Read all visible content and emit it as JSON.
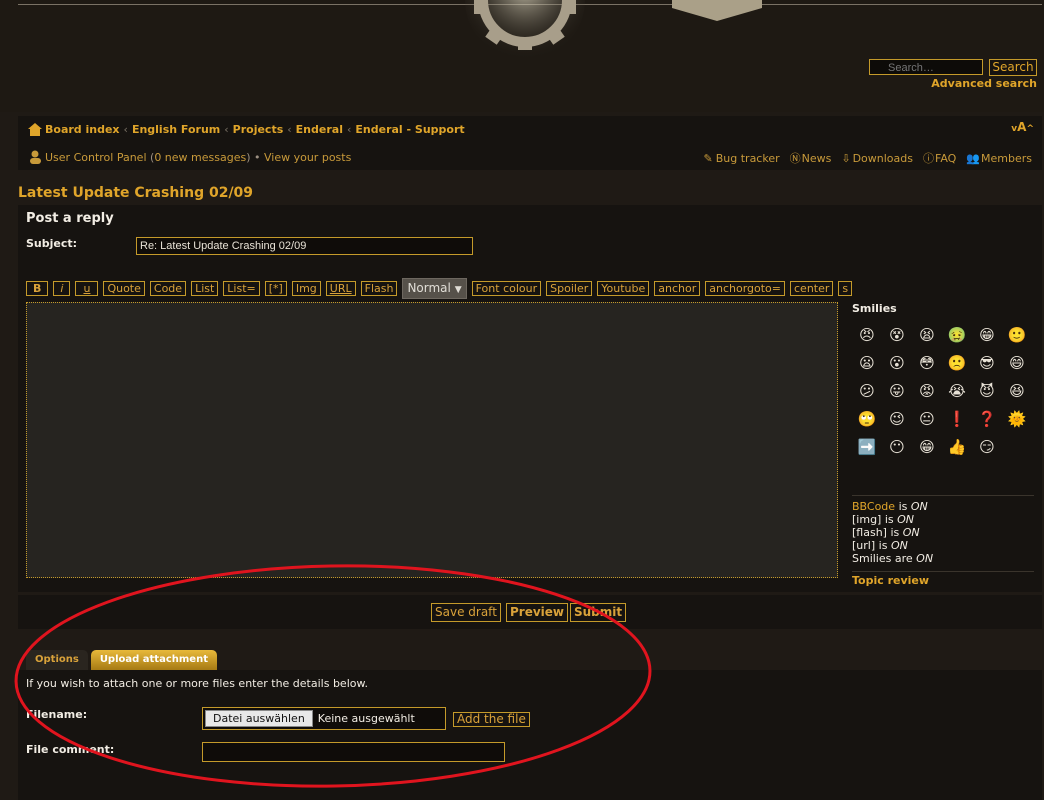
{
  "header": {
    "search_placeholder": "Search…",
    "search_button": "Search",
    "advanced_search": "Advanced search"
  },
  "nav": {
    "breadcrumbs": [
      "Board index",
      "English Forum",
      "Projects",
      "Enderal",
      "Enderal - Support"
    ],
    "font_size_label": "A",
    "ucp": "User Control Panel",
    "messages": "0 new messages",
    "view_posts": "View your posts",
    "links": [
      "Bug tracker",
      "News",
      "Downloads",
      "FAQ",
      "Members"
    ]
  },
  "topic": {
    "title": "Latest Update Crashing 02/09"
  },
  "post": {
    "heading": "Post a reply",
    "subject_label": "Subject:",
    "subject_value": "Re: Latest Update Crashing 02/09"
  },
  "toolbar": {
    "buttons": [
      "B",
      "i",
      "u",
      "Quote",
      "Code",
      "List",
      "List=",
      "[*]",
      "Img",
      "URL",
      "Flash"
    ],
    "size_select": "Normal",
    "buttons2": [
      "Font colour",
      "Spoiler",
      "Youtube",
      "anchor",
      "anchorgoto=",
      "center",
      "s"
    ]
  },
  "smilies": {
    "heading": "Smilies",
    "icons": [
      "😠",
      "😵",
      "😫",
      "🤢",
      "😁",
      "🙂",
      "😦",
      "😮",
      "😳",
      "🙁",
      "😎",
      "😄",
      "😕",
      "😛",
      "😡",
      "😭",
      "😈",
      "😆",
      "🙄",
      "😉",
      "😐",
      "❗",
      "❓",
      "🌞",
      "➡️",
      "😶",
      "😁",
      "👍",
      "😏"
    ]
  },
  "bbinfo": {
    "bbcode": "BBCode",
    "is": "is",
    "on": "ON",
    "img": "[img]",
    "flash": "[flash]",
    "url": "[url]",
    "smilies": "Smilies are",
    "topic_review": "Topic review"
  },
  "buttons": {
    "save_draft": "Save draft",
    "preview": "Preview",
    "submit": "Submit"
  },
  "tabs": {
    "options": "Options",
    "upload": "Upload attachment"
  },
  "attach": {
    "info": "If you wish to attach one or more files enter the details below.",
    "filename_label": "Filename:",
    "choose_button": "Datei auswählen",
    "no_file": "Keine ausgewählt",
    "add_file": "Add the file",
    "comment_label": "File comment:"
  },
  "colors": {
    "accent": "#e0a52a",
    "border": "#c49a2a",
    "annotation": "#e0141e"
  }
}
